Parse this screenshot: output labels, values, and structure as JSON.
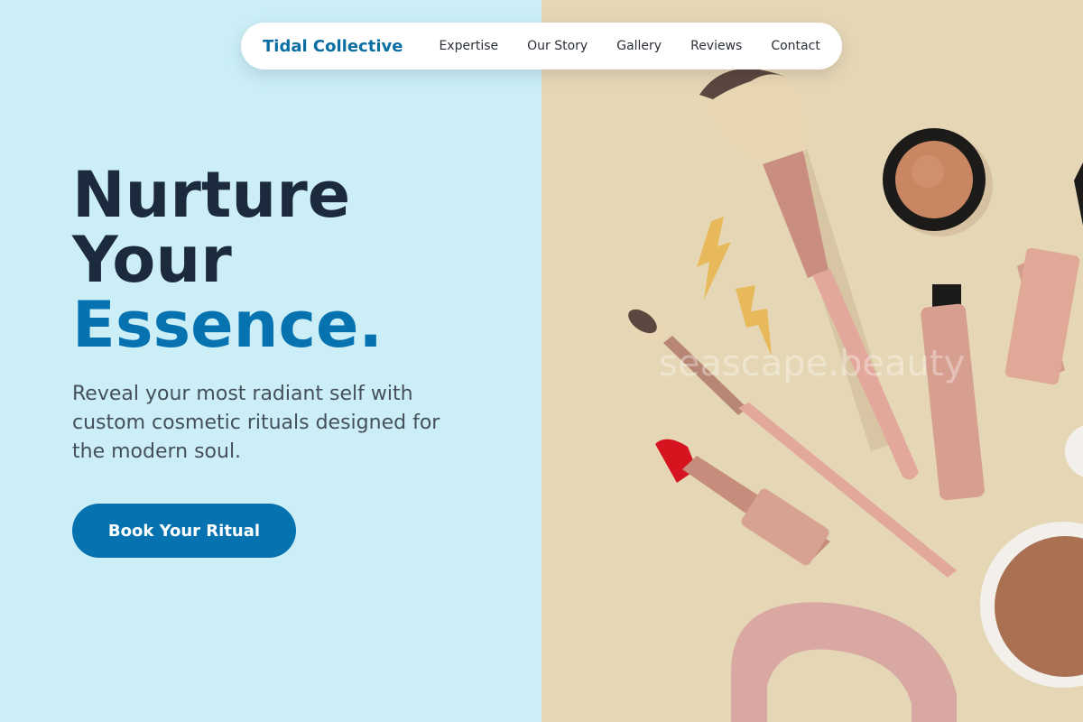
{
  "nav": {
    "brand": "Tidal Collective",
    "links": [
      "Expertise",
      "Our Story",
      "Gallery",
      "Reviews",
      "Contact"
    ]
  },
  "hero": {
    "title_line1": "Nurture",
    "title_line2": "Your",
    "title_line3": "Essence.",
    "subtitle": "Reveal your most radiant self with custom cosmetic rituals designed for the modern soul.",
    "cta_label": "Book Your Ritual"
  },
  "image": {
    "watermark": "seascape.beauty",
    "alt": "Makeup flat lay"
  },
  "colors": {
    "left_bg": "#cbeef7",
    "right_bg": "#e5d7b6",
    "brand": "#0a6ea3",
    "accent": "#0673b0",
    "heading": "#1c2a3d",
    "text": "#46505c"
  }
}
